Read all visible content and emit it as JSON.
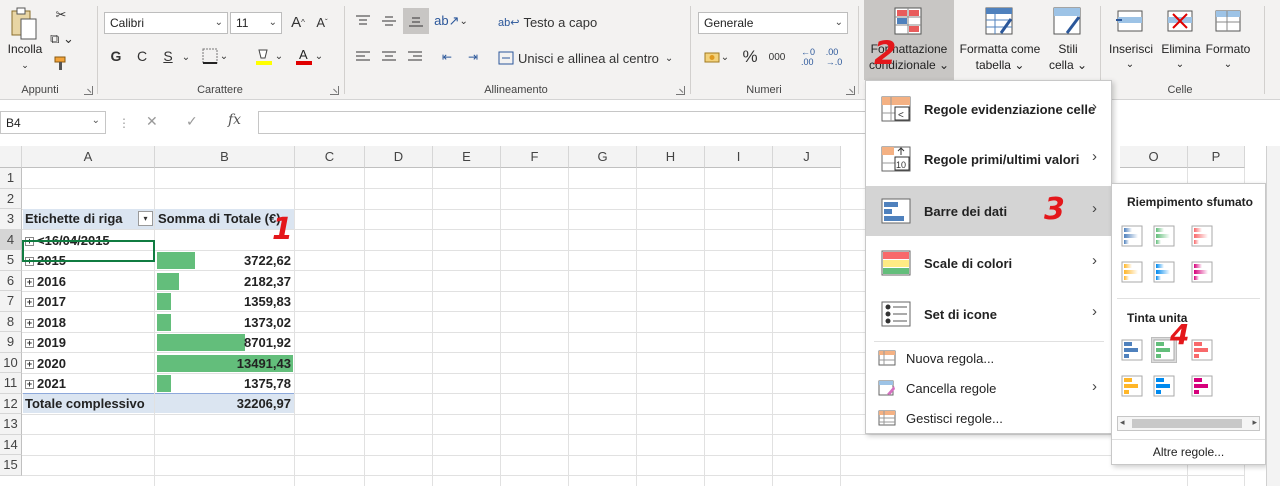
{
  "ribbon": {
    "paste_label": "Incolla",
    "groups": {
      "clipboard": "Appunti",
      "font": "Carattere",
      "alignment": "Allineamento",
      "number": "Numeri",
      "cells": "Celle"
    },
    "font_name": "Calibri",
    "font_size": "11",
    "bold": "G",
    "italic": "C",
    "underline": "S",
    "wrap_text": "Testo a capo",
    "merge_center": "Unisci e allinea al centro",
    "number_format": "Generale",
    "percent": "%",
    "thousands": "000",
    "conditional_formatting_l1": "Formattazione",
    "conditional_formatting_l2": "condizionale",
    "format_table_l1": "Formatta come",
    "format_table_l2": "tabella",
    "cell_styles_l1": "Stili",
    "cell_styles_l2": "cella",
    "insert": "Inserisci",
    "delete": "Elimina",
    "format": "Formato"
  },
  "formula_bar": {
    "name_box": "B4",
    "fx": "fx"
  },
  "grid": {
    "columns": [
      "A",
      "B",
      "C",
      "D",
      "E",
      "F",
      "G",
      "H",
      "I",
      "J",
      "O",
      "P"
    ],
    "rows": [
      "1",
      "2",
      "3",
      "4",
      "5",
      "6",
      "7",
      "8",
      "9",
      "10",
      "11",
      "12",
      "13",
      "14",
      "15"
    ],
    "header_a": "Etichette di riga",
    "header_b": "Somma di Totale (€)",
    "pivot_rows": [
      {
        "label": "<16/04/2015",
        "value": ""
      },
      {
        "label": "2015",
        "value": "3722,62"
      },
      {
        "label": "2016",
        "value": "2182,37"
      },
      {
        "label": "2017",
        "value": "1359,83"
      },
      {
        "label": "2018",
        "value": "1373,02"
      },
      {
        "label": "2019",
        "value": "8701,92"
      },
      {
        "label": "2020",
        "value": "13491,43"
      },
      {
        "label": "2021",
        "value": "1375,78"
      }
    ],
    "bar_values": [
      3722.62,
      2182.37,
      1359.83,
      1373.02,
      8701.92,
      13491.43,
      1375.78
    ],
    "total_label": "Totale complessivo",
    "total_value": "32206,97"
  },
  "cf_menu": {
    "highlight_rules": "Regole evidenziazione celle",
    "top_bottom": "Regole primi/ultimi valori",
    "data_bars": "Barre dei dati",
    "color_scales": "Scale di colori",
    "icon_sets": "Set di icone",
    "new_rule": "Nuova regola...",
    "clear_rules": "Cancella regole",
    "manage_rules": "Gestisci regole..."
  },
  "data_bars_submenu": {
    "gradient_title": "Riempimento sfumato",
    "solid_title": "Tinta unita",
    "more_rules": "Altre regole...",
    "gradient_colors": [
      "#4f81bd",
      "#63be7b",
      "#f8696b",
      "#ffb628",
      "#008aef",
      "#d6007b"
    ],
    "solid_colors": [
      "#4f81bd",
      "#63be7b",
      "#f8696b",
      "#ffb628",
      "#008aef",
      "#d6007b"
    ],
    "selected_index": 1
  },
  "annotations": [
    "1",
    "2",
    "3",
    "4"
  ],
  "colors": {
    "data_bar": "#63be7b",
    "pivot_header": "#dbe5f1",
    "excel_green": "#107c41",
    "annotation_red": "#e4171b"
  }
}
